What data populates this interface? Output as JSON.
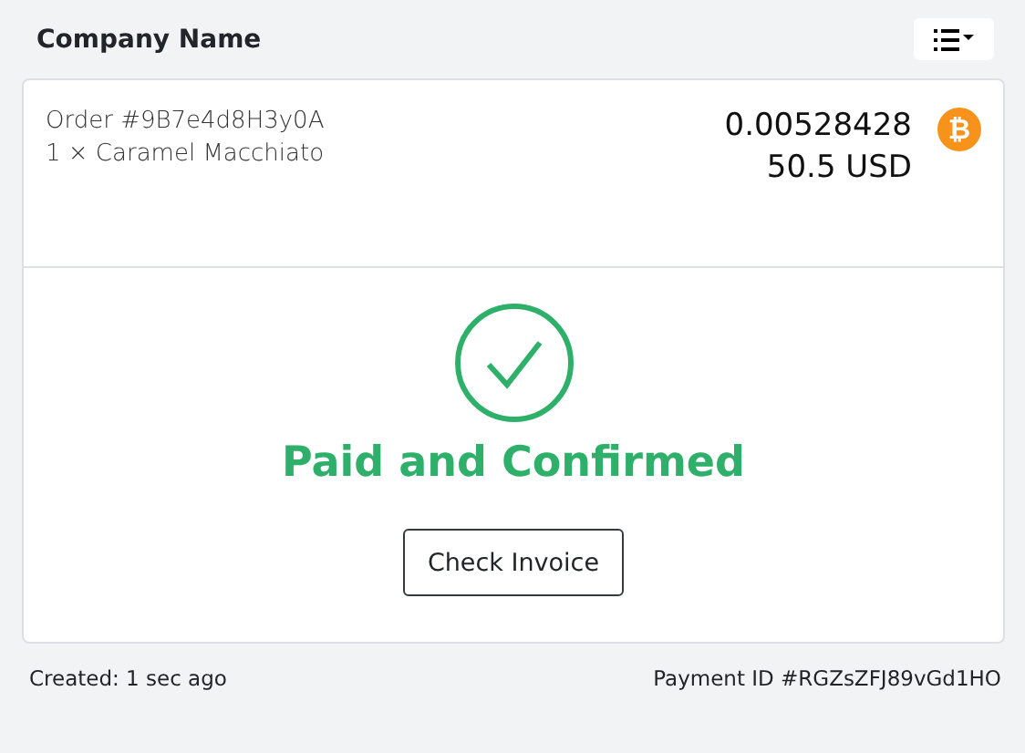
{
  "header": {
    "title": "Company Name"
  },
  "order": {
    "number": "Order #9B7e4d8H3y0A",
    "item": "1 × Caramel Macchiato",
    "amount": "0.00528428",
    "fiat": "50.5 USD",
    "coin_symbol": "₿"
  },
  "status": {
    "kind": "paid",
    "message": "Paid and Confirmed",
    "button": "Check Invoice"
  },
  "footer": {
    "created": "Created: 1 sec ago",
    "payment_id": "Payment ID #RGZsZFJ89vGd1HO"
  }
}
